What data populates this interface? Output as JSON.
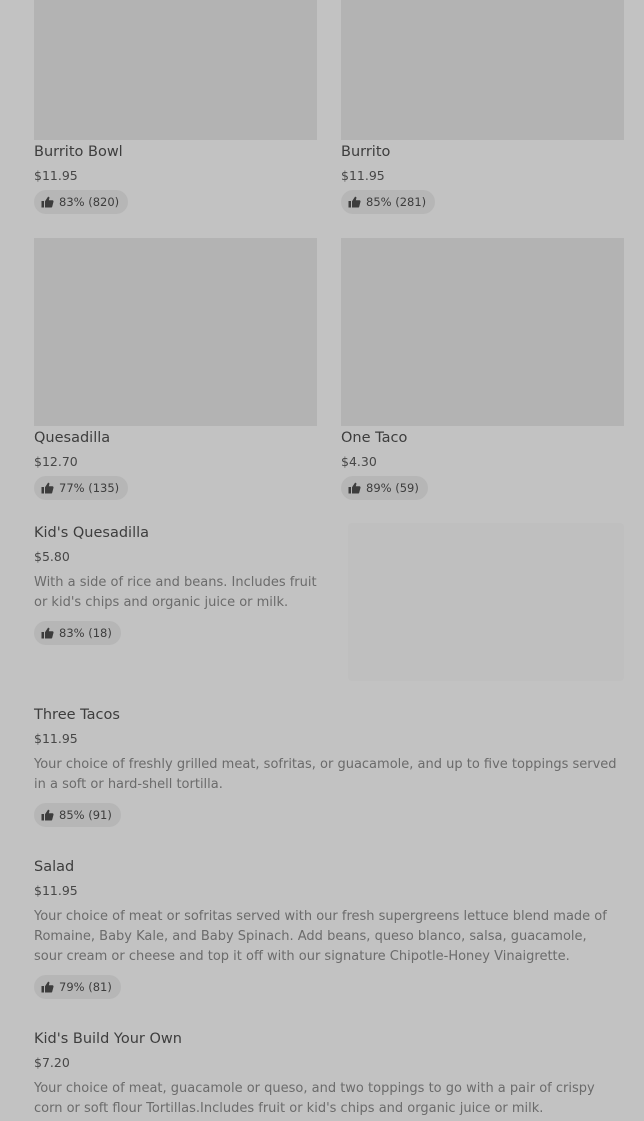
{
  "grid_items": [
    {
      "name": "Burrito Bowl",
      "price": "$11.95",
      "rating": "83% (820)"
    },
    {
      "name": "Burrito",
      "price": "$11.95",
      "rating": "85% (281)"
    },
    {
      "name": "Quesadilla",
      "price": "$12.70",
      "rating": "77% (135)"
    },
    {
      "name": "One Taco",
      "price": "$4.30",
      "rating": "89% (59)"
    }
  ],
  "list_items": [
    {
      "name": "Kid's Quesadilla",
      "price": "$5.80",
      "description": "With a side of rice and beans. Includes fruit or kid's chips and organic juice or milk.",
      "rating": "83% (18)"
    },
    {
      "name": "Three Tacos",
      "price": "$11.95",
      "description": "Your choice of freshly grilled meat, sofritas, or guacamole, and up to five toppings served in a soft or hard-shell tortilla.",
      "rating": "85% (91)"
    },
    {
      "name": "Salad",
      "price": "$11.95",
      "description": "Your choice of meat or sofritas served with our fresh supergreens lettuce blend made of Romaine, Baby Kale, and Baby Spinach. Add beans, queso blanco, salsa, guacamole, sour cream or cheese and top it off with our signature Chipotle-Honey Vinaigrette.",
      "rating": "79% (81)"
    },
    {
      "name": "Kid's Build Your Own",
      "price": "$7.20",
      "description": "Your choice of meat, guacamole or queso, and two toppings to go with a pair of crispy corn or soft flour Tortillas.Includes fruit or kid's chips and organic juice or milk."
    }
  ]
}
